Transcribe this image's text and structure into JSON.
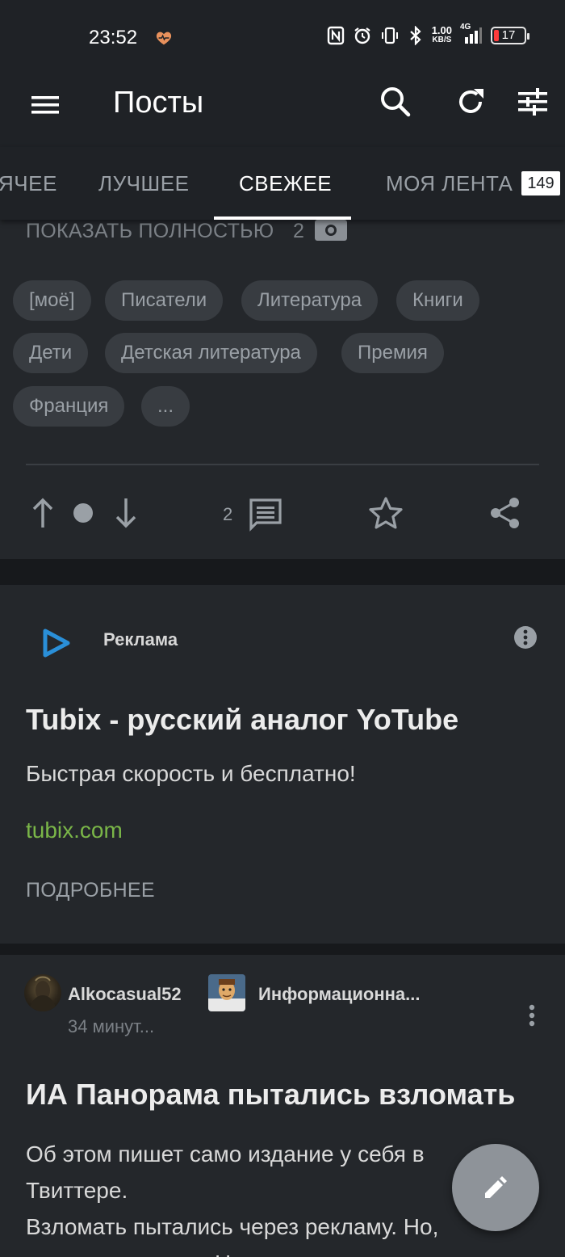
{
  "status_bar": {
    "time": "23:52",
    "net_speed_value": "1.00",
    "net_speed_unit": "KB/S",
    "network": "4G",
    "battery": "17",
    "battery_level": 0.17
  },
  "app_bar": {
    "title": "Посты"
  },
  "tabs": {
    "items": [
      "ГОРЯЧЕЕ",
      "ЛУЧШЕЕ",
      "СВЕЖЕЕ",
      "МОЯ ЛЕНТА"
    ],
    "visible_first_fragment": "ЯЧЕЕ",
    "active": "СВЕЖЕЕ",
    "feed_badge": "149"
  },
  "post1": {
    "show_full_label": "ПОКАЗАТЬ ПОЛНОСТЬЮ",
    "show_full_count": "2",
    "tags": [
      "[моё]",
      "Писатели",
      "Литература",
      "Книги",
      "Дети",
      "Детская литература",
      "Премия",
      "Франция",
      "..."
    ],
    "comments_count": "2"
  },
  "ad": {
    "label": "Реклама",
    "title": "Tubix - русский аналог YoTube",
    "subtitle": "Быстрая скорость и бесплатно!",
    "link": "tubix.com",
    "cta": "ПОДРОБНЕЕ",
    "link_color": "#7ab648"
  },
  "post2": {
    "author": "Alkocasual52",
    "community": "Информационна...",
    "time": "34 минут...",
    "title": "ИА Панорама пытались взломать",
    "body_lines": [
      "Об этом пишет само издание у себя в",
      "Твиттере.",
      "Взломать пытались через рекламу. Но,",
      "цитируя издание: Не учли, что на связи"
    ]
  },
  "colors": {
    "background": "#24272b",
    "bar": "#1f2226",
    "accent_green": "#7ab648",
    "chip": "#383c41"
  }
}
